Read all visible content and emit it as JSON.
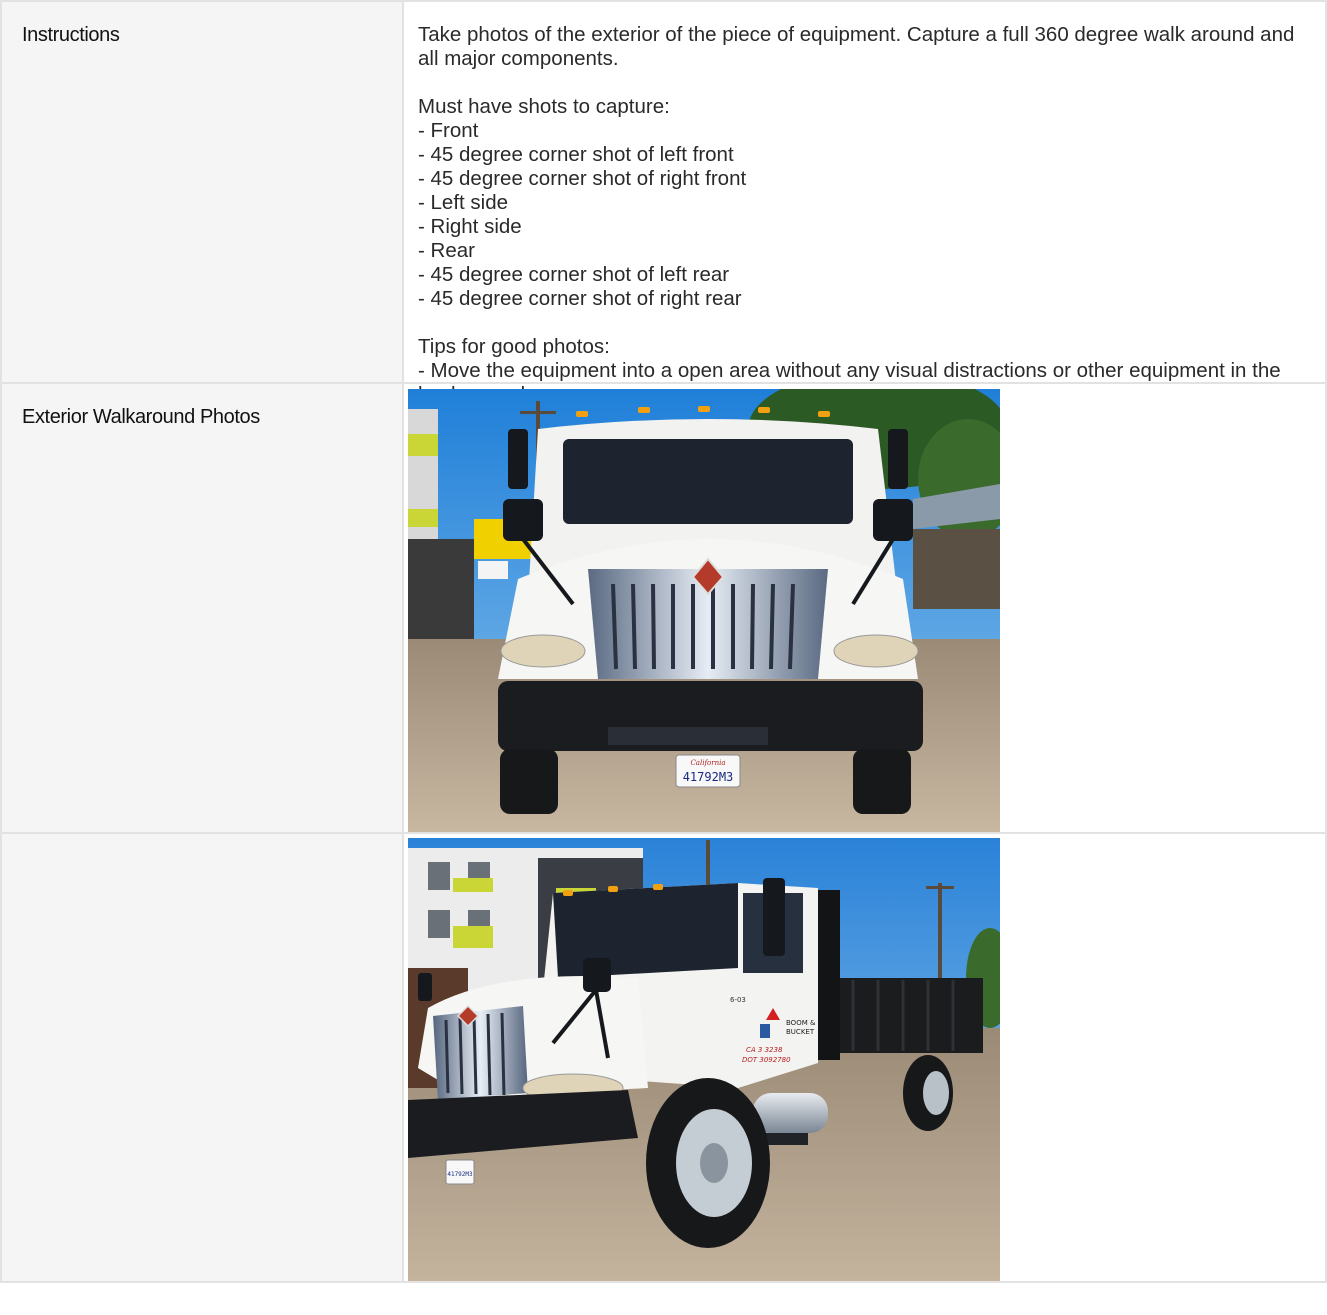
{
  "rows": {
    "instructions": {
      "label": "Instructions",
      "intro": "Take photos of the exterior of the piece of equipment. Capture a full 360 degree walk around and all major components.",
      "must_have_heading": "Must have shots to capture:",
      "must_have": [
        "- Front",
        "- 45 degree corner shot of left front",
        "- 45 degree corner shot of right front",
        "- Left side",
        "- Right side",
        "- Rear",
        "- 45 degree corner shot of left rear",
        "- 45 degree corner shot of right rear"
      ],
      "tips_heading": "Tips for good photos:",
      "tips": [
        "- Move the equipment into a open area without any visual distractions or other equipment in the background"
      ]
    },
    "photos": {
      "label": "Exterior Walkaround Photos",
      "photo1": {
        "plate": "41792M3",
        "plate_state": "California"
      },
      "photo2": {
        "door_text_line1": "BOOM &",
        "door_text_line2": "BUCKET",
        "door_number_1": "CA 3 3238",
        "door_number_2": "DOT 3092780",
        "cab_number": "6-03",
        "plate": "41792M3"
      }
    },
    "empty_label": ""
  }
}
